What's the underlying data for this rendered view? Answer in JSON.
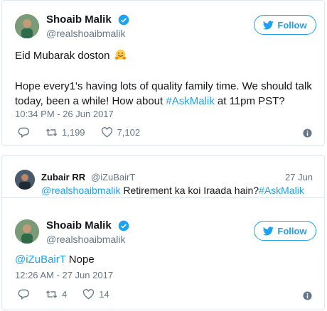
{
  "tweet1": {
    "author_name": "Shoaib Malik",
    "author_handle": "@realshoaibmalik",
    "follow_label": "Follow",
    "line1": "Eid Mubarak doston",
    "line2_pre": "Hope every1's having lots of quality family time. We should talk today, been a while! How about ",
    "hashtag": "#AskMalik",
    "line2_post": " at 11pm PST?",
    "timestamp": "10:34 PM - 26 Jun 2017",
    "retweets": "1,199",
    "likes": "7,102"
  },
  "reply": {
    "author_name": "Zubair RR",
    "author_handle": "@iZuBairT",
    "date": "27 Jun",
    "mention": "@realshoaibmalik",
    "text": " Retirement ka koi Iraada hain?",
    "hashtag": "#AskMalik"
  },
  "tweet2": {
    "author_name": "Shoaib Malik",
    "author_handle": "@realshoaibmalik",
    "follow_label": "Follow",
    "mention": "@iZuBairT",
    "text": " Nope",
    "timestamp": "12:26 AM - 27 Jun 2017",
    "retweets": "4",
    "likes": "14"
  },
  "colors": {
    "brand": "#1da1f2",
    "secondary_text": "#657786",
    "border": "#e1e8ed"
  },
  "icons": [
    "verified-badge-icon",
    "twitter-bird-icon",
    "reply-icon",
    "retweet-icon",
    "heart-icon",
    "info-icon",
    "hugging-face-emoji"
  ]
}
